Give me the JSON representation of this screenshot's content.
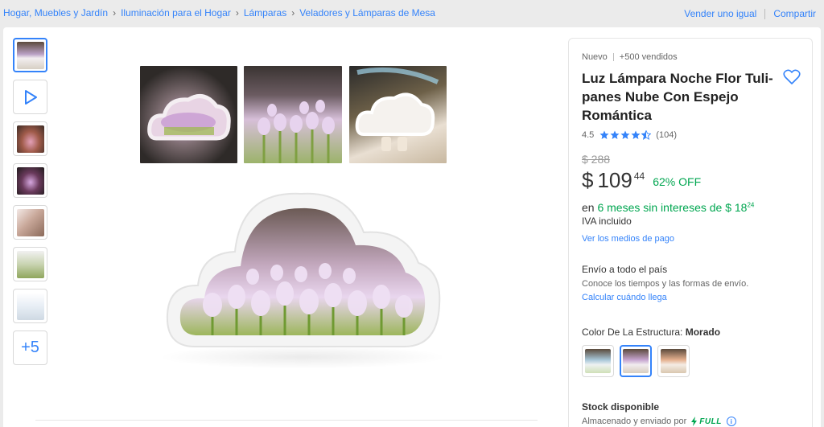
{
  "breadcrumb": {
    "items": [
      "Hogar, Muebles y Jardín",
      "Iluminación para el Hogar",
      "Lámparas",
      "Veladores y Lámparas de Mesa"
    ],
    "separator": "›"
  },
  "top_actions": {
    "sell_label": "Vender uno igual",
    "share_label": "Compartir"
  },
  "thumbnails": {
    "more_label": "+5"
  },
  "product": {
    "condition": "Nuevo",
    "sold": "+500 vendidos",
    "title": "Luz Lámpara Noche Flor Tuli-panes Nube Con Espejo Romántica",
    "rating_score": "4.5",
    "rating_value": 4.5,
    "reviews": "(104)",
    "old_price": "$ 288",
    "currency": "$",
    "price": "109",
    "price_cents": "44",
    "discount": "62% OFF",
    "installments_prefix": "en ",
    "installments_green": "6 meses sin intereses de $ 18",
    "installments_cents": "24",
    "tax_note": "IVA incluido",
    "payment_link": "Ver los medios de pago",
    "shipping_title": "Envío a todo el país",
    "shipping_sub": "Conoce los tiempos y las formas de envío.",
    "shipping_link": "Calcular cuándo llega",
    "color_label": "Color De La Estructura: ",
    "color_value": "Morado",
    "stock": "Stock disponible",
    "stored_text": "Almacenado y enviado por",
    "full_label": "FULL",
    "info_icon": "i"
  },
  "colors": {
    "accent": "#3483fa",
    "green": "#00a650"
  }
}
